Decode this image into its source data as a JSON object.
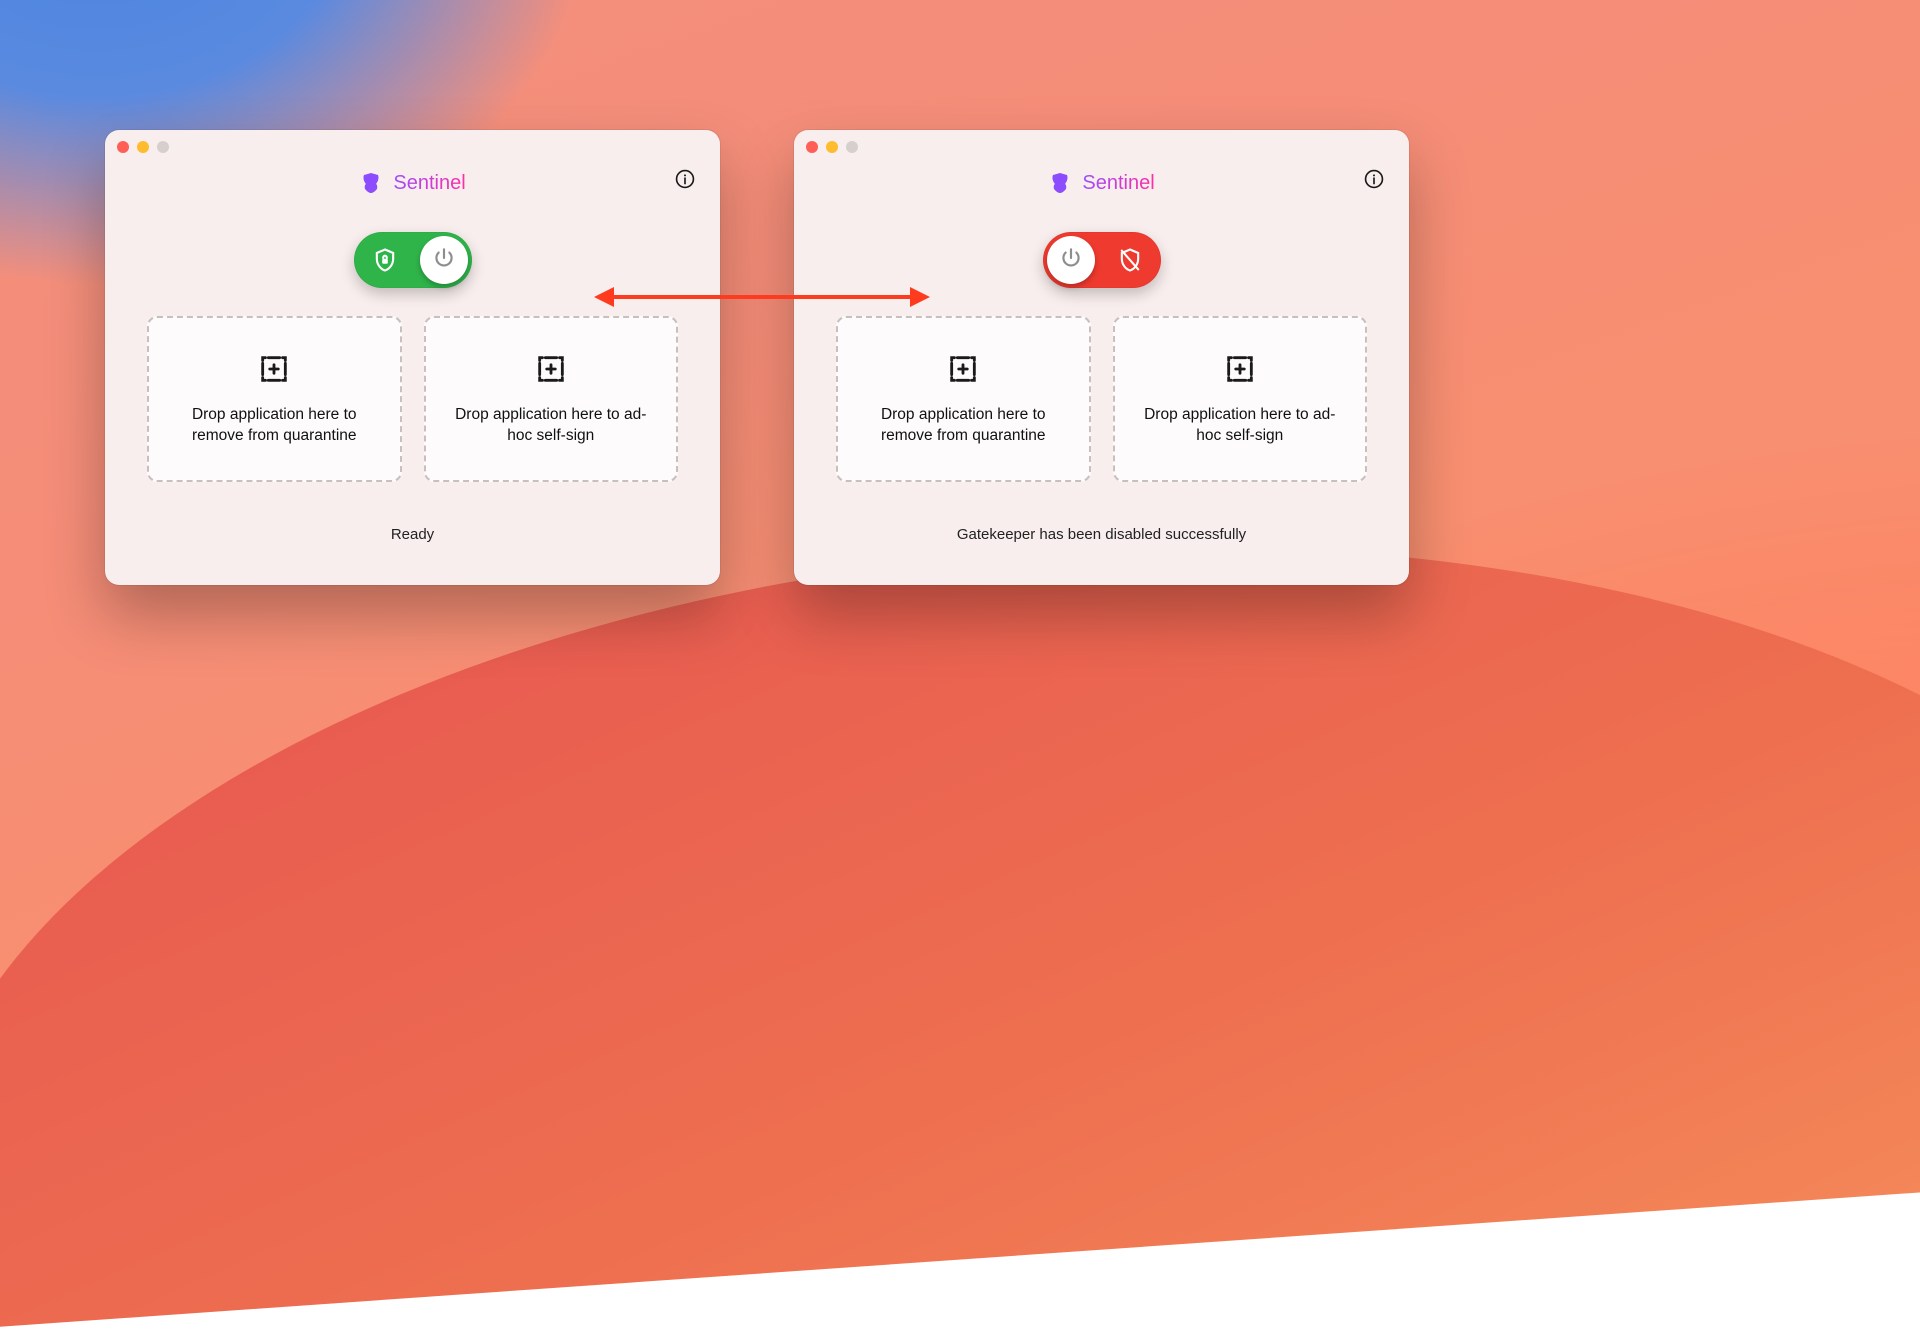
{
  "colors": {
    "toggle_on": "#2fb44a",
    "toggle_off": "#ef3a2f",
    "brand_gradient_from": "#9b4dff",
    "brand_gradient_to": "#ff2ea6"
  },
  "windowLeft": {
    "app_title": "Sentinel",
    "toggle_state": "on",
    "dropzones": {
      "quarantine": "Drop application here to remove from quarantine",
      "selfsign": "Drop application here to ad-hoc self-sign"
    },
    "status": "Ready"
  },
  "windowRight": {
    "app_title": "Sentinel",
    "toggle_state": "off",
    "dropzones": {
      "quarantine": "Drop application here to remove from quarantine",
      "selfsign": "Drop application here to ad-hoc self-sign"
    },
    "status": "Gatekeeper has been disabled successfully"
  }
}
